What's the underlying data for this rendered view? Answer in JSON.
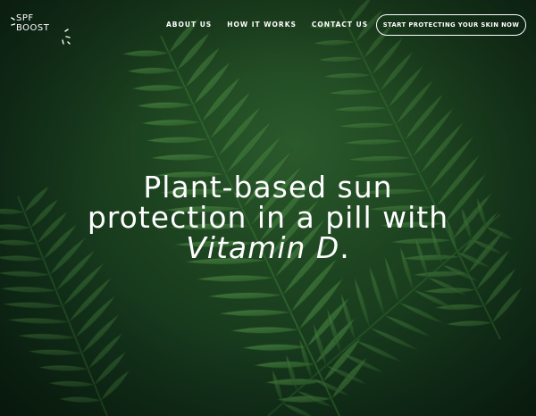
{
  "brand": {
    "line1": "SPF",
    "line2": "BOOST"
  },
  "nav": {
    "items": [
      {
        "label": "ABOUT US"
      },
      {
        "label": "HOW IT WORKS"
      },
      {
        "label": "CONTACT US"
      }
    ]
  },
  "cta": {
    "label": "START PROTECTING YOUR SKIN NOW"
  },
  "hero": {
    "line1": "Plant-based sun",
    "line2": "protection in a pill with",
    "line3_italic": "Vitamin D",
    "line3_end": "."
  },
  "colors": {
    "background": "#1d4420",
    "text": "#ffffff",
    "leaf": "#3f7a3a"
  },
  "icons": {
    "logo_mark": "sun-rays-icon"
  }
}
